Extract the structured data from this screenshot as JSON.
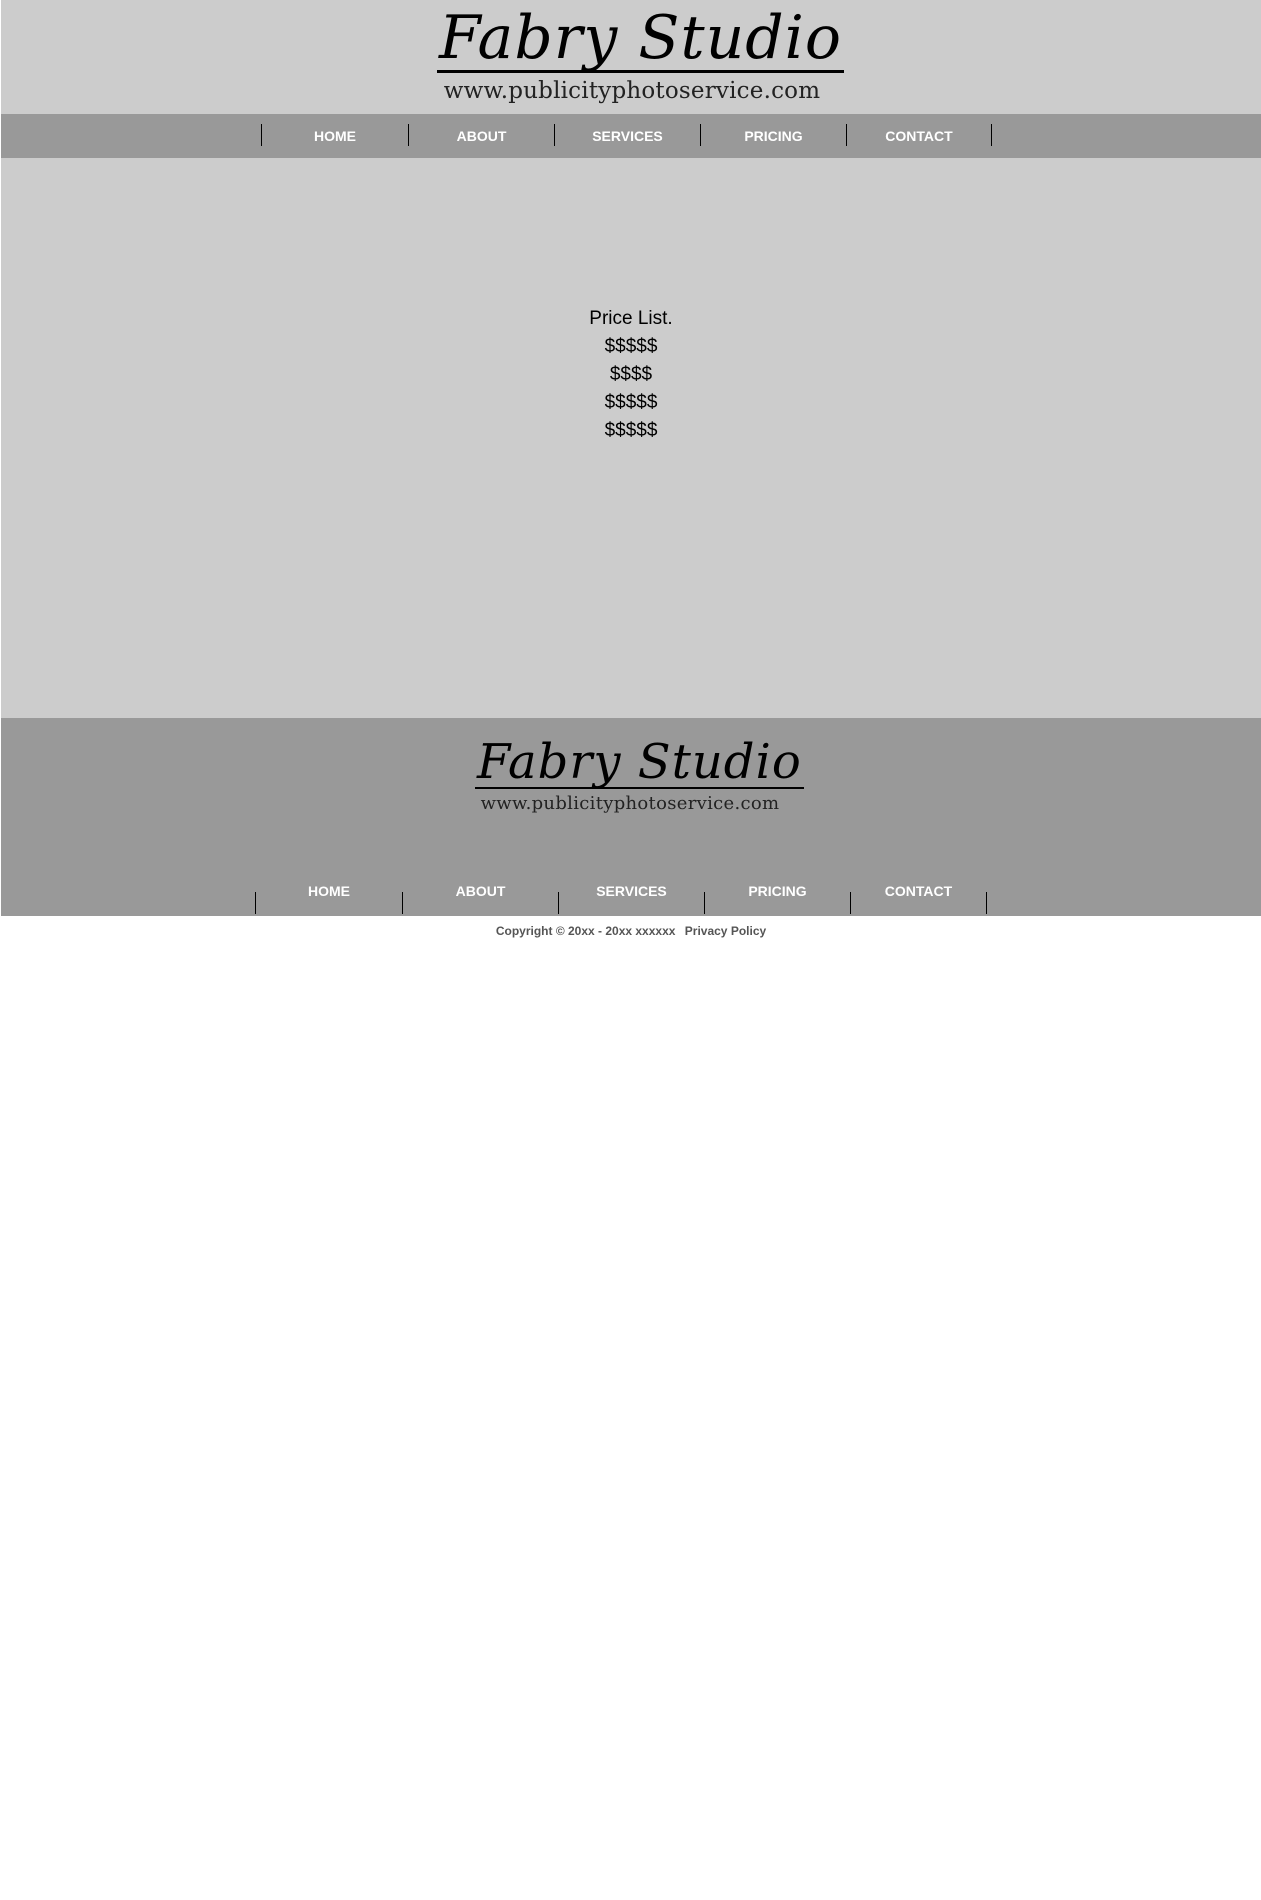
{
  "brand": {
    "title": "Fabry Studio",
    "url": "www.publicityphotoservice.com"
  },
  "nav": {
    "items": [
      {
        "label": "HOME"
      },
      {
        "label": "ABOUT"
      },
      {
        "label": "SERVICES"
      },
      {
        "label": "PRICING"
      },
      {
        "label": "CONTACT"
      }
    ]
  },
  "main": {
    "heading": "Price List.",
    "prices": [
      "$$$$$",
      "$$$$",
      "$$$$$",
      "$$$$$"
    ]
  },
  "footer": {
    "copyright": "Copyright © 20xx - 20xx xxxxxx",
    "privacy_label": "Privacy Policy"
  },
  "colors": {
    "header_bg": "#cccccc",
    "nav_bg": "#999999",
    "nav_text": "#ffffff",
    "page_bg": "#ffffff"
  }
}
